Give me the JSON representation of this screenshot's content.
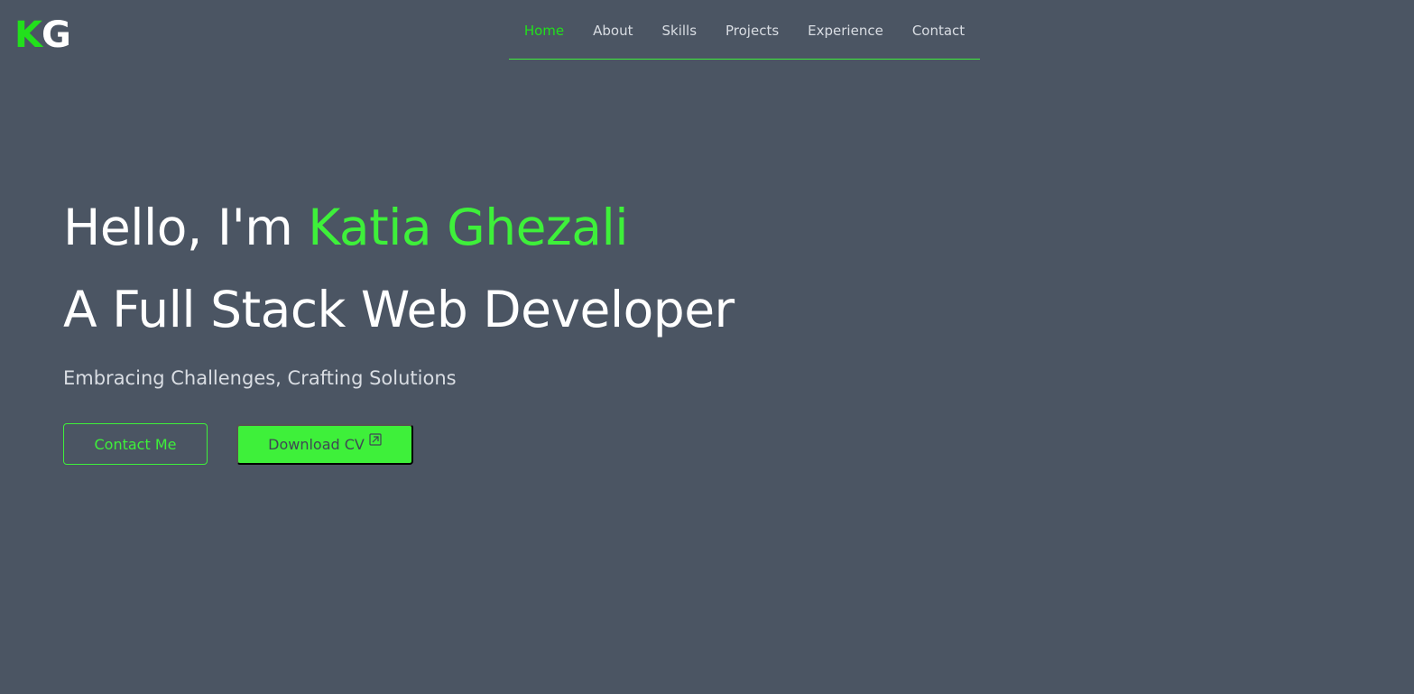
{
  "logo": {
    "first": "K",
    "second": "G"
  },
  "nav": {
    "items": [
      {
        "label": "Home",
        "active": true
      },
      {
        "label": "About",
        "active": false
      },
      {
        "label": "Skills",
        "active": false
      },
      {
        "label": "Projects",
        "active": false
      },
      {
        "label": "Experience",
        "active": false
      },
      {
        "label": "Contact",
        "active": false
      }
    ]
  },
  "hero": {
    "greeting": "Hello, I'm ",
    "name": "Katia Ghezali",
    "role": "A Full Stack Web Developer",
    "tagline": "Embracing Challenges, Crafting Solutions"
  },
  "buttons": {
    "contact_label": "Contact Me",
    "download_label": "Download CV",
    "download_icon": "external-link-icon"
  },
  "colors": {
    "background": "#4b5563",
    "accent": "#3ef03a",
    "text": "#ffffff",
    "muted_text": "#d9dde3"
  }
}
